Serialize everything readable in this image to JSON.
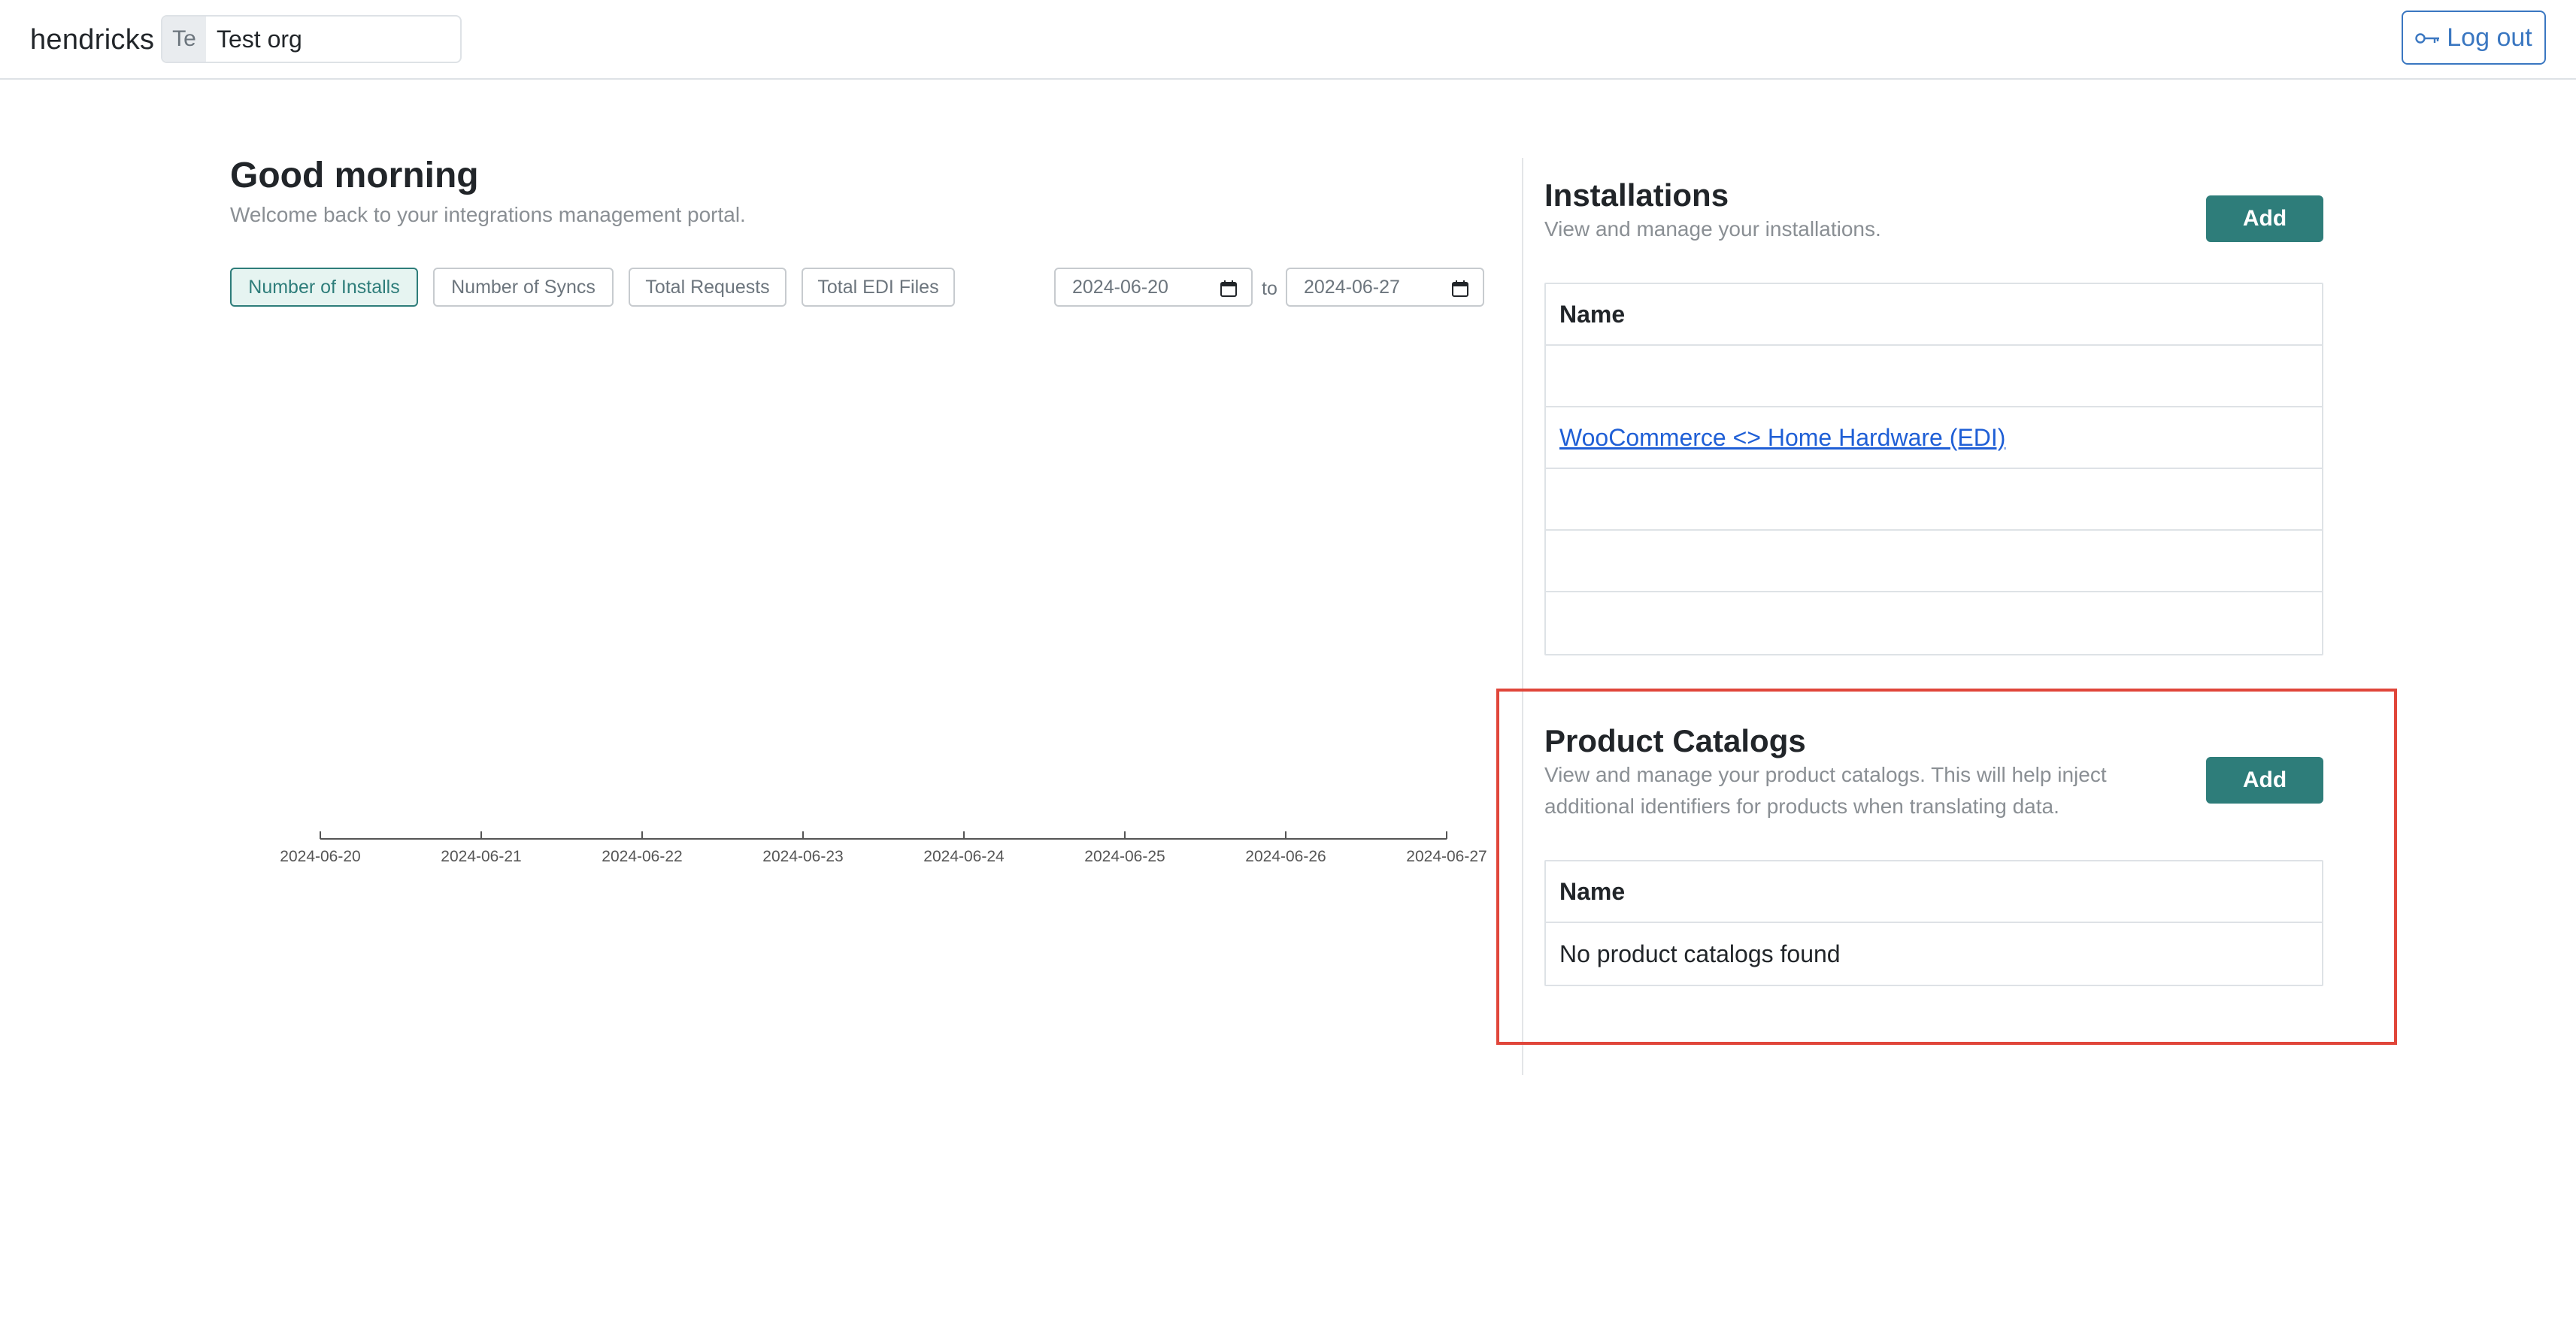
{
  "header": {
    "brand": "hendricks",
    "org_avatar": "Te",
    "org_name": "Test org",
    "logout_label": "Log out",
    "logout_icon": "key-icon"
  },
  "dashboard": {
    "greeting": "Good morning",
    "subtitle": "Welcome back to your integrations management portal.",
    "filters": [
      {
        "label": "Number of Installs",
        "active": true
      },
      {
        "label": "Number of Syncs",
        "active": false
      },
      {
        "label": "Total Requests",
        "active": false
      },
      {
        "label": "Total EDI Files",
        "active": false
      }
    ],
    "date_from": "2024-06-20",
    "date_to": "2024-06-27",
    "date_separator": "to"
  },
  "chart_data": {
    "type": "line",
    "x": [
      "2024-06-20",
      "2024-06-21",
      "2024-06-22",
      "2024-06-23",
      "2024-06-24",
      "2024-06-25",
      "2024-06-26",
      "2024-06-27"
    ],
    "series": [],
    "title": "",
    "xlabel": "",
    "ylabel": ""
  },
  "installations": {
    "title": "Installations",
    "description": "View and manage your installations.",
    "add_label": "Add",
    "column_header": "Name",
    "rows": [
      "",
      "WooCommerce <> Home Hardware (EDI)",
      "",
      "",
      ""
    ]
  },
  "product_catalogs": {
    "title": "Product Catalogs",
    "description_line1": "View and manage your product catalogs. This will help inject",
    "description_line2": "additional identifiers for products when translating data.",
    "add_label": "Add",
    "column_header": "Name",
    "empty_message": "No product catalogs found"
  },
  "colors": {
    "accent": "#2e7d7a",
    "link": "#1f5fd6",
    "logout": "#3a77c1",
    "highlight": "#e0463a"
  }
}
